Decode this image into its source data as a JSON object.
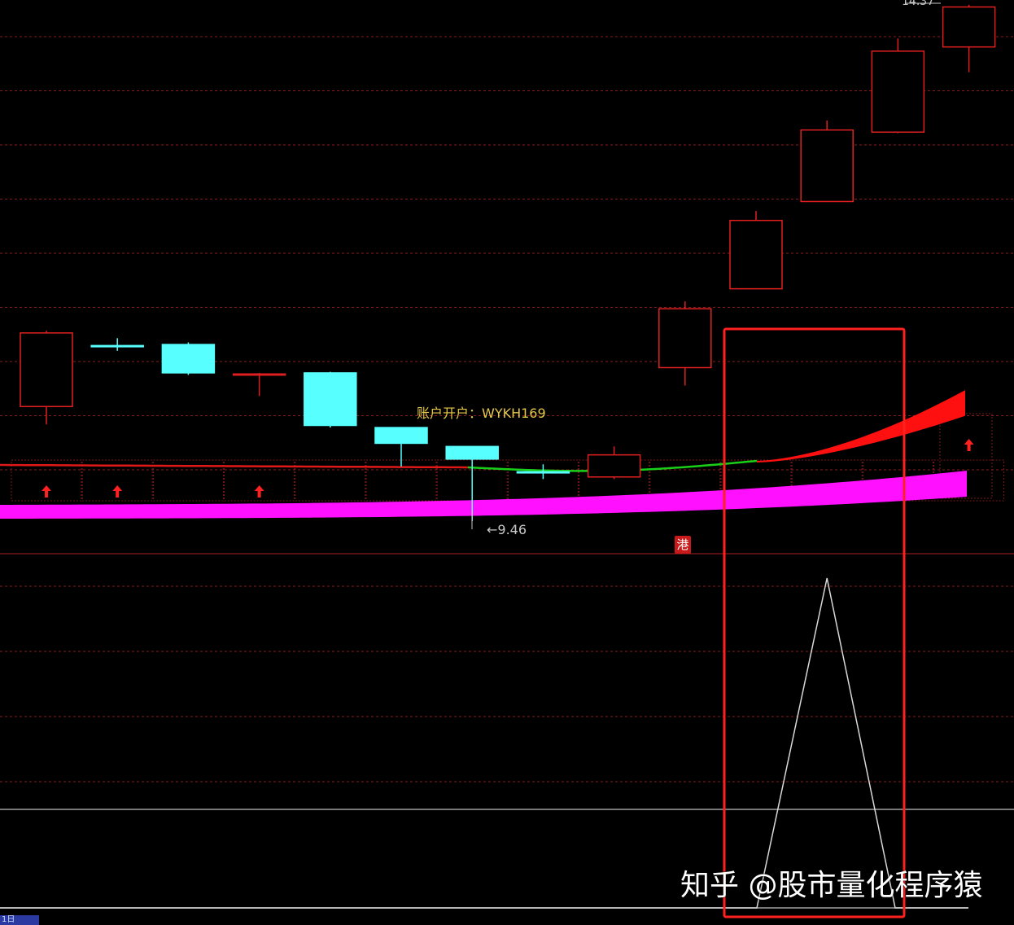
{
  "chart_data": {
    "type": "candlestick",
    "price_pane": {
      "candles": [
        {
          "open": 10.55,
          "high": 11.27,
          "low": 10.38,
          "close": 11.25,
          "direction": "up",
          "signal": "up-arrow"
        },
        {
          "open": 11.13,
          "high": 11.2,
          "low": 11.08,
          "close": 11.13,
          "direction": "doji",
          "signal": "up-arrow"
        },
        {
          "open": 11.14,
          "high": 11.16,
          "low": 10.85,
          "close": 10.87,
          "direction": "down",
          "signal": ""
        },
        {
          "open": 10.86,
          "high": 10.87,
          "low": 10.65,
          "close": 10.85,
          "direction": "doji",
          "signal": "up-arrow"
        },
        {
          "open": 10.87,
          "high": 10.88,
          "low": 10.35,
          "close": 10.37,
          "direction": "down",
          "signal": ""
        },
        {
          "open": 10.35,
          "high": 10.34,
          "low": 9.98,
          "close": 10.2,
          "direction": "down",
          "signal": ""
        },
        {
          "open": 10.17,
          "high": 10.17,
          "low": 9.46,
          "close": 10.05,
          "direction": "down",
          "signal": ""
        },
        {
          "open": 9.92,
          "high": 10.0,
          "low": 9.86,
          "close": 9.93,
          "direction": "doji",
          "signal": ""
        },
        {
          "open": 9.88,
          "high": 10.17,
          "low": 9.86,
          "close": 10.09,
          "direction": "up",
          "signal": ""
        },
        {
          "open": 10.92,
          "high": 11.55,
          "low": 10.75,
          "close": 11.48,
          "direction": "up",
          "signal": ""
        },
        {
          "open": 11.67,
          "high": 12.41,
          "low": 11.67,
          "close": 12.32,
          "direction": "up",
          "signal": ""
        },
        {
          "open": 12.5,
          "high": 13.27,
          "low": 12.5,
          "close": 13.18,
          "direction": "up",
          "signal": ""
        },
        {
          "open": 13.16,
          "high": 14.05,
          "low": 13.15,
          "close": 13.93,
          "direction": "up",
          "signal": ""
        },
        {
          "open": 13.97,
          "high": 14.37,
          "low": 13.73,
          "close": 14.35,
          "direction": "up",
          "signal": "up-arrow"
        }
      ],
      "trend_line_colors": [
        "#e01818",
        "#18d018",
        "#e01818"
      ],
      "band_colors": {
        "upper": "#ff1010",
        "lower": "#ff10ff"
      },
      "min_label": "9.46",
      "max_label": "14.37",
      "highlight_box": {
        "color": "#ff2020",
        "candle_index": 10
      }
    },
    "indicator_pane": {
      "type": "line",
      "color": "#d8d8d8",
      "values": [
        0,
        0,
        0,
        0,
        0,
        0,
        0,
        0,
        0,
        0,
        0,
        1,
        0,
        0
      ]
    }
  },
  "labels": {
    "account": "账户开户：WYKH169",
    "low_value": "←9.46",
    "high_value": "14.37",
    "port_badge": "港",
    "watermark": "知乎 @股市量化程序猿",
    "corner_tab": "1日"
  },
  "colors": {
    "background": "#000000",
    "grid": "#8a1a1a",
    "up_candle": "#e02020",
    "down_candle": "#58ffff"
  }
}
